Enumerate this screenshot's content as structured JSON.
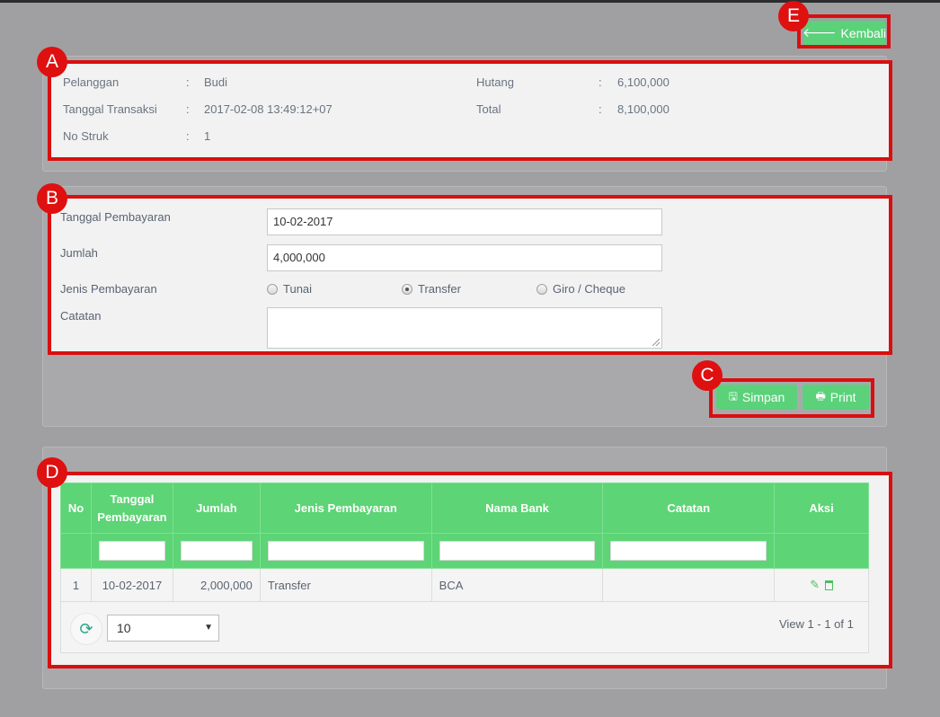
{
  "header": {
    "back_label": "Kembali"
  },
  "markers": {
    "a": "A",
    "b": "B",
    "c": "C",
    "d": "D",
    "e": "E"
  },
  "transaction_info": {
    "customer_label": "Pelanggan",
    "customer_value": "Budi",
    "date_label": "Tanggal Transaksi",
    "date_value": "2017-02-08 13:49:12+07",
    "receipt_label": "No Struk",
    "receipt_value": "1",
    "debt_label": "Hutang",
    "debt_value": "6,100,000",
    "total_label": "Total",
    "total_value": "8,100,000",
    "separator": ":"
  },
  "payment_form": {
    "date_label": "Tanggal Pembayaran",
    "date_value": "10-02-2017",
    "amount_label": "Jumlah",
    "amount_value": "4,000,000",
    "type_label": "Jenis Pembayaran",
    "type_options": [
      "Tunai",
      "Transfer",
      "Giro / Cheque"
    ],
    "type_selected": "Transfer",
    "note_label": "Catatan",
    "note_value": ""
  },
  "actions": {
    "save_label": "Simpan",
    "print_label": "Print"
  },
  "payments_table": {
    "columns": [
      "No",
      "Tanggal Pembayaran",
      "Jumlah",
      "Jenis Pembayaran",
      "Nama Bank",
      "Catatan",
      "Aksi"
    ],
    "rows": [
      {
        "no": "1",
        "date": "10-02-2017",
        "amount": "2,000,000",
        "type": "Transfer",
        "bank": "BCA",
        "note": ""
      }
    ],
    "page_size": "10",
    "view_info": "View 1 - 1 of 1"
  },
  "colors": {
    "accent_green": "#5dd475",
    "highlight_red": "#d90f0f"
  },
  "icons": {
    "back": "arrow-left-icon",
    "save": "floppy-disk-icon",
    "print": "printer-icon",
    "edit": "pencil-icon",
    "delete": "trash-icon",
    "refresh": "refresh-icon"
  }
}
